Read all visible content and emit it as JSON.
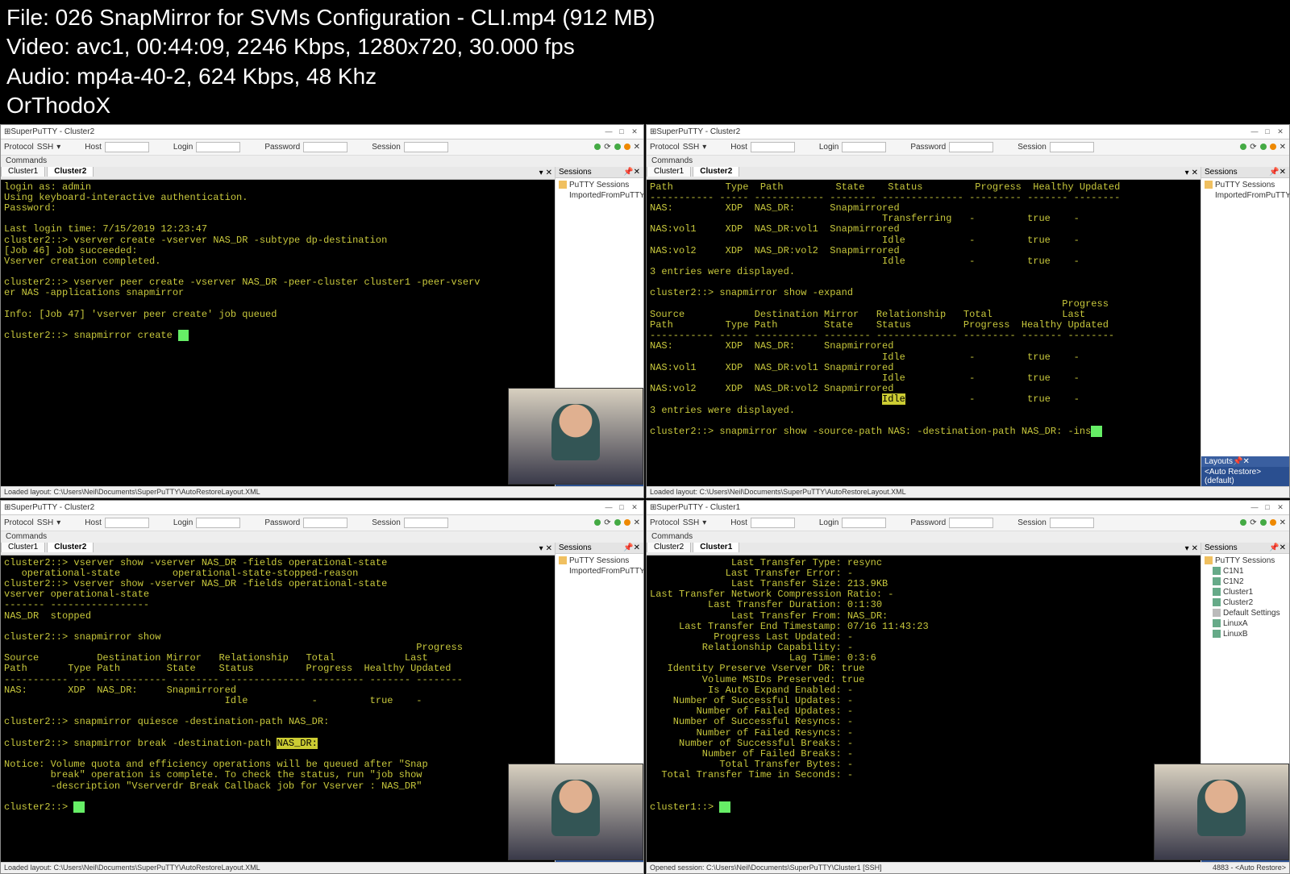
{
  "header": {
    "file_line": "File: 026 SnapMirror for SVMs Configuration - CLI.mp4 (912 MB)",
    "video_line": "Video: avc1, 00:44:09, 2246 Kbps, 1280x720, 30.000 fps",
    "audio_line": "Audio: mp4a-40-2, 624 Kbps, 48 Khz",
    "tag": "OrThodoX"
  },
  "toolbar_labels": {
    "protocol": "Protocol",
    "protocol_value": "SSH",
    "host": "Host",
    "login": "Login",
    "password": "Password",
    "session": "Session"
  },
  "menubar": {
    "commands": "Commands"
  },
  "side_panels": {
    "sessions_title": "Sessions",
    "layouts_title": "Layouts",
    "auto_restore": "<Auto Restore> (default)"
  },
  "windows": [
    {
      "title": "SuperPuTTY - Cluster2",
      "tabs": [
        "Cluster1",
        "Cluster2"
      ],
      "active_tab": 1,
      "status": "Loaded layout: C:\\Users\\Neil\\Documents\\SuperPuTTY\\AutoRestoreLayout.XML",
      "sessions_tree": [
        {
          "label": "PuTTY Sessions",
          "icon": "folder"
        },
        {
          "label": "ImportedFromPuTTY",
          "icon": "folder",
          "indent": 1
        }
      ],
      "terminal": "login as: admin\nUsing keyboard-interactive authentication.\nPassword:\n\nLast login time: 7/15/2019 12:23:47\ncluster2::> vserver create -vserver NAS_DR -subtype dp-destination\n[Job 46] Job succeeded:\nVserver creation completed.\n\ncluster2::> vserver peer create -vserver NAS_DR -peer-cluster cluster1 -peer-vserv\ner NAS -applications snapmirror\n\nInfo: [Job 47] 'vserver peer create' job queued\n\ncluster2::> snapmirror create ▮"
    },
    {
      "title": "SuperPuTTY - Cluster2",
      "tabs": [
        "Cluster1",
        "Cluster2"
      ],
      "active_tab": 1,
      "status": "Loaded layout: C:\\Users\\Neil\\Documents\\SuperPuTTY\\AutoRestoreLayout.XML",
      "sessions_tree": [
        {
          "label": "PuTTY Sessions",
          "icon": "folder"
        },
        {
          "label": "ImportedFromPuTTY",
          "icon": "folder",
          "indent": 1
        }
      ],
      "terminal": "Path         Type  Path         State    Status         Progress  Healthy Updated\n----------- ----- ------------ -------- -------------- --------- ------- --------\nNAS:         XDP  NAS_DR:      Snapmirrored\n                                        Transferring   -         true    -\nNAS:vol1     XDP  NAS_DR:vol1  Snapmirrored\n                                        Idle           -         true    -\nNAS:vol2     XDP  NAS_DR:vol2  Snapmirrored\n                                        Idle           -         true    -\n3 entries were displayed.\n\ncluster2::> snapmirror show -expand\n                                                                       Progress\nSource            Destination Mirror   Relationship   Total            Last\nPath         Type Path        State    Status         Progress  Healthy Updated\n----------- ----- ----------- -------- -------------- --------- ------- --------\nNAS:         XDP  NAS_DR:     Snapmirrored\n                                        Idle           -         true    -\nNAS:vol1     XDP  NAS_DR:vol1 Snapmirrored\n                                        Idle           -         true    -\nNAS:vol2     XDP  NAS_DR:vol2 Snapmirrored\n                                        ⟨Idle⟩           -         true    -\n3 entries were displayed.\n\ncluster2::> snapmirror show -source-path NAS: -destination-path NAS_DR: -ins▮"
    },
    {
      "title": "SuperPuTTY - Cluster2",
      "tabs": [
        "Cluster1",
        "Cluster2"
      ],
      "active_tab": 1,
      "status": "Loaded layout: C:\\Users\\Neil\\Documents\\SuperPuTTY\\AutoRestoreLayout.XML",
      "sessions_tree": [
        {
          "label": "PuTTY Sessions",
          "icon": "folder"
        },
        {
          "label": "ImportedFromPuTTY",
          "icon": "folder",
          "indent": 1
        }
      ],
      "terminal": "cluster2::> vserver show -vserver NAS_DR -fields operational-state\n   operational-state         operational-state-stopped-reason\ncluster2::> vserver show -vserver NAS_DR -fields operational-state\nvserver operational-state\n------- -----------------\nNAS_DR  stopped\n\ncluster2::> snapmirror show\n                                                                       Progress\nSource          Destination Mirror   Relationship   Total            Last\nPath       Type Path        State    Status         Progress  Healthy Updated\n----------- ---- ----------- -------- -------------- --------- ------- --------\nNAS:       XDP  NAS_DR:     Snapmirrored\n                                      Idle           -         true    -\n\ncluster2::> snapmirror quiesce -destination-path NAS_DR:\n\ncluster2::> snapmirror break -destination-path ⟨NAS_DR:⟩\n\nNotice: Volume quota and efficiency operations will be queued after \"Snap\n        break\" operation is complete. To check the status, run \"job show\n        -description \"Vserverdr Break Callback job for Vserver : NAS_DR\"\n\ncluster2::> ▮"
    },
    {
      "title": "SuperPuTTY - Cluster1",
      "tabs": [
        "Cluster2",
        "Cluster1"
      ],
      "active_tab": 1,
      "status": "Opened session: C:\\Users\\Neil\\Documents\\SuperPuTTY\\Cluster1 [SSH]",
      "status_right": "4883 - <Auto Restore>",
      "sessions_tree": [
        {
          "label": "PuTTY Sessions",
          "icon": "folder"
        },
        {
          "label": "C1N1",
          "icon": "db",
          "indent": 1
        },
        {
          "label": "C1N2",
          "icon": "db",
          "indent": 1
        },
        {
          "label": "Cluster1",
          "icon": "db",
          "indent": 1
        },
        {
          "label": "Cluster2",
          "icon": "db",
          "indent": 1
        },
        {
          "label": "Default Settings",
          "icon": "file",
          "indent": 1
        },
        {
          "label": "LinuxA",
          "icon": "db",
          "indent": 1
        },
        {
          "label": "LinuxB",
          "icon": "db",
          "indent": 1
        }
      ],
      "terminal": "              Last Transfer Type: resync\n             Last Transfer Error: -\n              Last Transfer Size: 213.9KB\nLast Transfer Network Compression Ratio: -\n          Last Transfer Duration: 0:1:30\n              Last Transfer From: NAS_DR:\n     Last Transfer End Timestamp: 07/16 11:43:23\n           Progress Last Updated: -\n         Relationship Capability: -\n                        Lag Time: 0:3:6\n   Identity Preserve Vserver DR: true\n         Volume MSIDs Preserved: true\n          Is Auto Expand Enabled: -\n    Number of Successful Updates: -\n        Number of Failed Updates: -\n    Number of Successful Resyncs: -\n        Number of Failed Resyncs: -\n     Number of Successful Breaks: -\n         Number of Failed Breaks: -\n            Total Transfer Bytes: -\n  Total Transfer Time in Seconds: -\n\n\ncluster1::> ▮"
    }
  ]
}
